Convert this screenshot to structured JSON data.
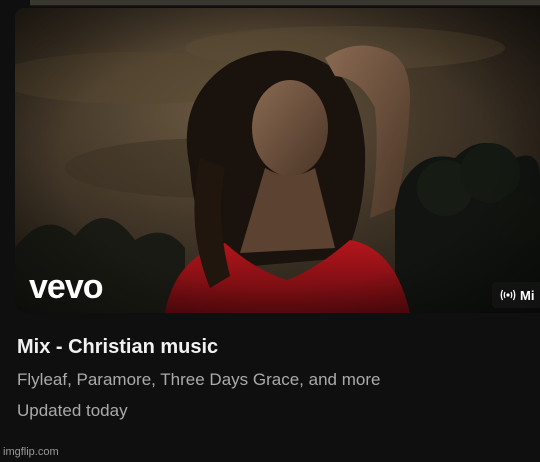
{
  "playlist": {
    "title": "Mix - Christian music",
    "subtitle": "Flyleaf, Paramore, Three Days Grace, and more",
    "updated": "Updated today"
  },
  "thumbnail": {
    "logo_text": "vevo",
    "badge_icon": "broadcast-icon",
    "badge_label": "Mi"
  },
  "watermark": "imgflip.com",
  "colors": {
    "background": "#0f0f0f",
    "title": "#f1f1f1",
    "secondary_text": "#aaaaaa",
    "dress": "#a3141a"
  }
}
